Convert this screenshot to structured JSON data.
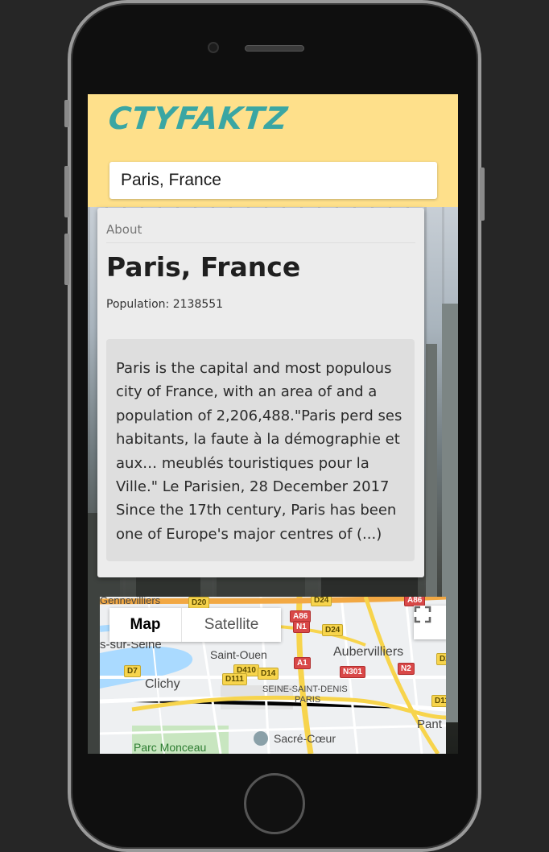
{
  "app": {
    "logo": "CTYFAKTZ"
  },
  "search": {
    "value": "Paris, France"
  },
  "card": {
    "section_label": "About",
    "city_name": "Paris, France",
    "population": "Population: 2138551",
    "description": "Paris is the capital and most populous city of France, with an area of and a population of 2,206,488.\"Paris perd ses habitants, la faute à la démographie et aux… meublés touristiques pour la Ville.\" Le Parisien, 28 December 2017 Since the 17th century, Paris has been one of Europe's major centres of (...)"
  },
  "map": {
    "toggle": {
      "map_label": "Map",
      "satellite_label": "Satellite"
    },
    "places": {
      "gennevilliers": "Gennevilliers",
      "sur_seine": "s-sur-Seine",
      "saint_ouen": "Saint-Ouen",
      "aubervilliers": "Aubervilliers",
      "clichy": "Clichy",
      "seine_saint_denis": "SEINE-SAINT-DENIS",
      "paris": "PARIS",
      "sacre_coeur": "Sacré-Cœur",
      "parc_monceau": "Parc Monceau",
      "pant": "Pant"
    },
    "roads": {
      "d20": "D20",
      "d24_top": "D24",
      "a86_top": "A86",
      "a86": "A86",
      "n1": "N1",
      "d24": "D24",
      "d2": "D2",
      "a1": "A1",
      "d7": "D7",
      "d410": "D410",
      "n301": "N301",
      "n2": "N2",
      "d14": "D14",
      "d111": "D111",
      "d11": "D11"
    },
    "colors": {
      "major_road": "#f7d44c",
      "highway": "#f2a843",
      "park": "#c8e6c0",
      "water": "#aadaff"
    }
  },
  "theme": {
    "header_bg": "#fee08b",
    "logo_color": "#3aa6a3",
    "card_bg": "#ececec"
  }
}
